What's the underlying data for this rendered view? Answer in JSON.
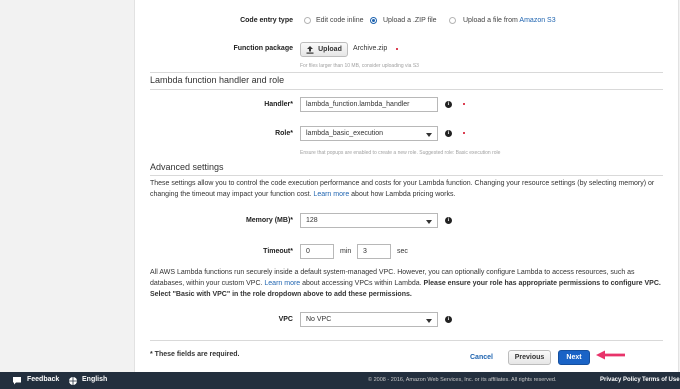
{
  "code_entry": {
    "label": "Code entry type",
    "options": [
      "Edit code inline",
      "Upload a .ZIP file",
      "Upload a file from Amazon S3"
    ],
    "selected": "Upload a .ZIP file"
  },
  "function_package": {
    "label": "Function package",
    "upload_label": "Upload",
    "file_name": "Archive.zip",
    "hint": "For files larger than 10 MB, consider uploading via S3"
  },
  "handler_section": {
    "heading": "Lambda function handler and role",
    "handler_label": "Handler*",
    "handler_value": "lambda_function.lambda_handler",
    "role_label": "Role*",
    "role_value": "lambda_basic_execution",
    "role_hint": "Ensure that popups are enabled to create a new role. Suggested role: Basic execution role"
  },
  "advanced": {
    "heading": "Advanced settings",
    "desc_part1": "These settings allow you to control the code execution performance and costs for your Lambda function. Changing your resource settings (by selecting memory) or changing the timeout may impact your function cost. ",
    "desc_link": "Learn more",
    "desc_part2": " about how Lambda pricing works.",
    "memory_label": "Memory (MB)*",
    "memory_value": "128",
    "timeout_label": "Timeout*",
    "timeout_min": "0",
    "min_unit": "min",
    "timeout_sec": "3",
    "sec_unit": "sec",
    "vpc_part1": "All AWS Lambda functions run securely inside a default system-managed VPC. However, you can optionally configure Lambda to access resources, such as databases, within your custom VPC. ",
    "vpc_link": "Learn more",
    "vpc_part2": " about accessing VPCs within Lambda. ",
    "vpc_bold": "Please ensure your role has appropriate permissions to configure VPC. Select \"Basic with VPC\" in the role dropdown above to add these permissions.",
    "vpc_label": "VPC",
    "vpc_value": "No VPC"
  },
  "actions": {
    "required_note": "* These fields are required.",
    "cancel": "Cancel",
    "previous": "Previous",
    "next": "Next"
  },
  "footer": {
    "feedback": "Feedback",
    "language": "English",
    "copyright": "© 2008 - 2016, Amazon Web Services, Inc. or its affiliates. All rights reserved.",
    "privacy": "Privacy Policy",
    "terms": "Terms of Use"
  },
  "colors": {
    "accent": "#1f64b0",
    "primary_button": "#1a63c6",
    "arrow": "#e8336a",
    "footer_bg": "#232f3e"
  },
  "icons": [
    "upload-icon",
    "info-icon",
    "dropdown-arrow-icon",
    "speech-bubble-icon",
    "globe-icon",
    "pointer-arrow-icon"
  ]
}
